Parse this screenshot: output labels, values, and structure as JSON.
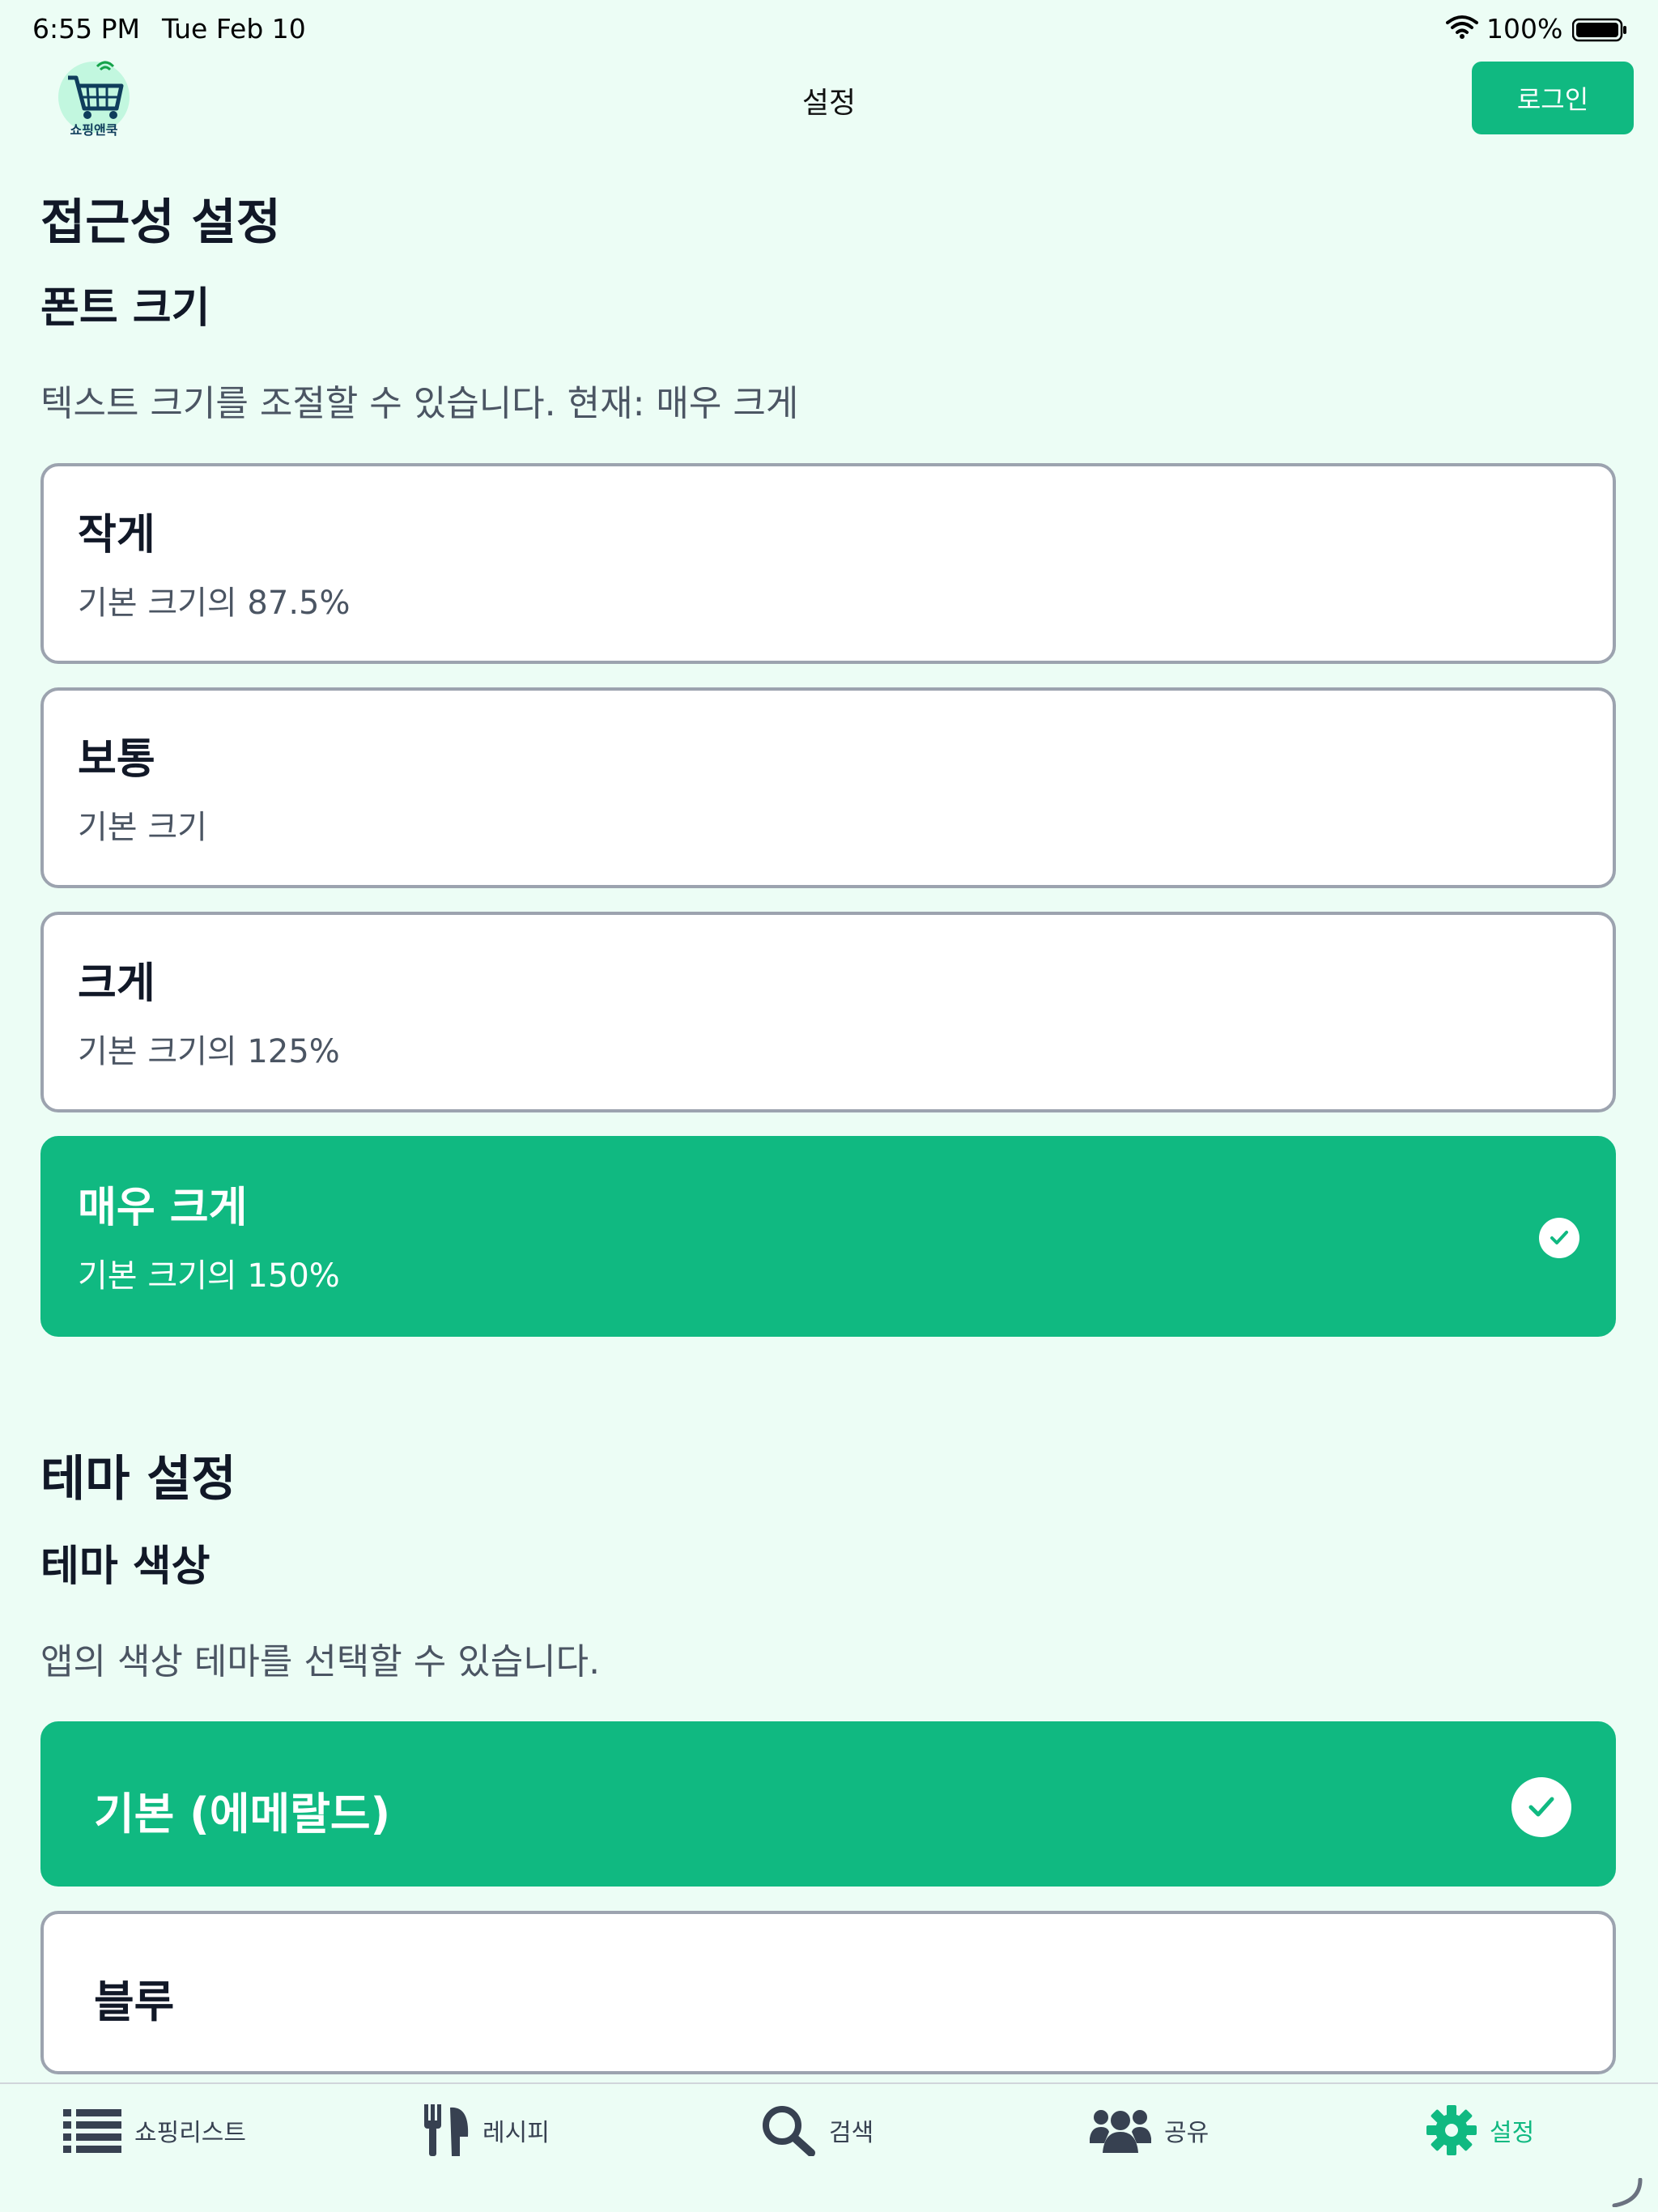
{
  "status_bar": {
    "time": "6:55 PM",
    "date": "Tue Feb 10",
    "battery": "100%"
  },
  "header": {
    "logo_text": "쇼핑앤쿡",
    "title": "설정",
    "login_label": "로그인"
  },
  "accessibility": {
    "section_title": "접근성 설정",
    "font_size_title": "폰트 크기",
    "font_size_desc": "텍스트 크기를 조절할 수 있습니다. 현재: 매우 크게",
    "options": [
      {
        "title": "작게",
        "subtitle": "기본 크기의 87.5%",
        "selected": false
      },
      {
        "title": "보통",
        "subtitle": "기본 크기",
        "selected": false
      },
      {
        "title": "크게",
        "subtitle": "기본 크기의 125%",
        "selected": false
      },
      {
        "title": "매우 크게",
        "subtitle": "기본 크기의 150%",
        "selected": true
      }
    ]
  },
  "theme": {
    "section_title": "테마 설정",
    "color_title": "테마 색상",
    "color_desc": "앱의 색상 테마를 선택할 수 있습니다.",
    "options": [
      {
        "label": "기본 (에메랄드)",
        "selected": true
      },
      {
        "label": "블루",
        "selected": false
      }
    ]
  },
  "tabs": [
    {
      "label": "쇼핑리스트",
      "icon": "list-icon",
      "active": false
    },
    {
      "label": "레시피",
      "icon": "utensils-icon",
      "active": false
    },
    {
      "label": "검색",
      "icon": "search-icon",
      "active": false
    },
    {
      "label": "공유",
      "icon": "users-icon",
      "active": false
    },
    {
      "label": "설정",
      "icon": "gear-icon",
      "active": true
    }
  ],
  "colors": {
    "accent": "#10b981",
    "background": "#ecfdf5",
    "card_border": "#9ca3af",
    "text_primary": "#111827",
    "text_secondary": "#4b5563"
  }
}
